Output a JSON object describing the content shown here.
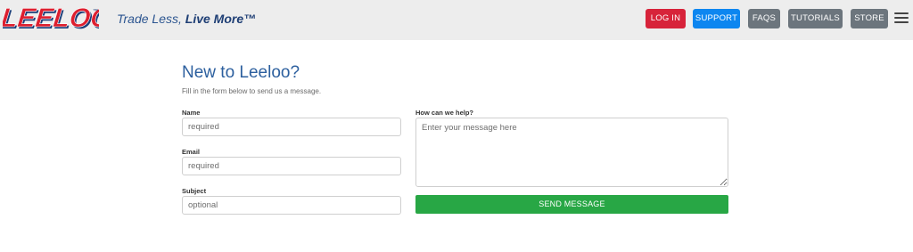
{
  "header": {
    "logo_text": "LEELOO",
    "logo_tm": "™",
    "tagline_light": "Trade Less, ",
    "tagline_bold": "Live More™",
    "nav": {
      "login": "LOG IN",
      "support": "SUPPORT",
      "faqs": "FAQS",
      "tutorials": "TUTORIALS",
      "store": "STORE"
    }
  },
  "form": {
    "title": "New to Leeloo?",
    "subtitle": "Fill in the form below to send us a message.",
    "name_label": "Name",
    "name_placeholder": "required",
    "email_label": "Email",
    "email_placeholder": "required",
    "subject_label": "Subject",
    "subject_placeholder": "optional",
    "help_label": "How can we help?",
    "help_placeholder": "Enter your message here",
    "send_label": "SEND MESSAGE"
  },
  "colors": {
    "login": "#d7233a",
    "support": "#0d86f0",
    "secondary": "#6c757d",
    "send": "#28a745",
    "title": "#2c5f9e"
  }
}
